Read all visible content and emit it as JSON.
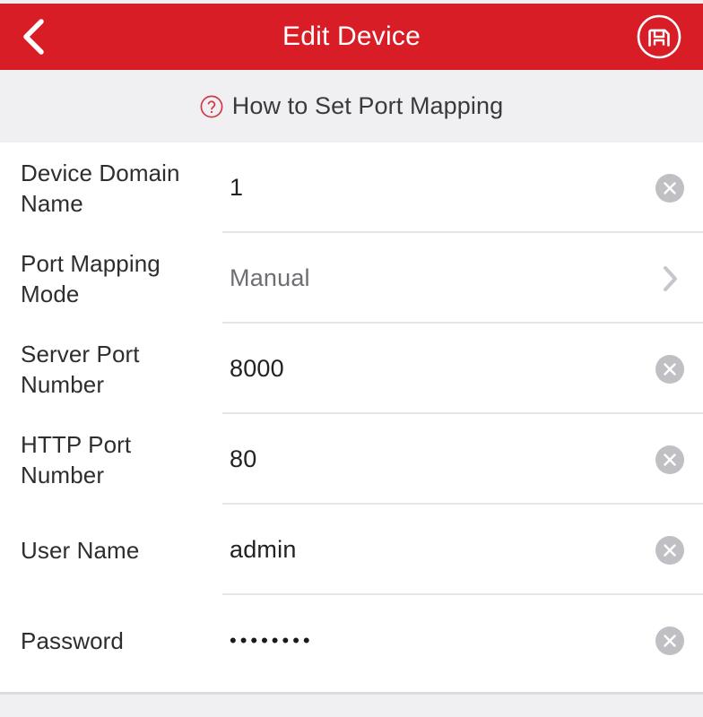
{
  "header": {
    "title": "Edit Device",
    "back_icon": "chevron-left-icon",
    "save_icon": "save-disk-icon",
    "background_color": "#d91d26",
    "text_color": "#ffffff"
  },
  "help": {
    "icon": "question-circle-icon",
    "label": "How to Set Port Mapping",
    "icon_color": "#d91d26"
  },
  "form": {
    "rows": [
      {
        "label": "Device Domain Name",
        "value": "1",
        "placeholder": "",
        "control": "clear-icon",
        "muted": false
      },
      {
        "label": "Port Mapping Mode",
        "value": "Manual",
        "placeholder": "",
        "control": "chevron-right-icon",
        "muted": true
      },
      {
        "label": "Server Port Number",
        "value": "8000",
        "placeholder": "",
        "control": "clear-icon",
        "muted": false
      },
      {
        "label": "HTTP Port Number",
        "value": "80",
        "placeholder": "",
        "control": "clear-icon",
        "muted": false
      },
      {
        "label": "User Name",
        "value": "admin",
        "placeholder": "",
        "control": "clear-icon",
        "muted": false
      },
      {
        "label": "Password",
        "value": "••••••••",
        "placeholder": "",
        "control": "clear-icon",
        "muted": false
      }
    ]
  }
}
